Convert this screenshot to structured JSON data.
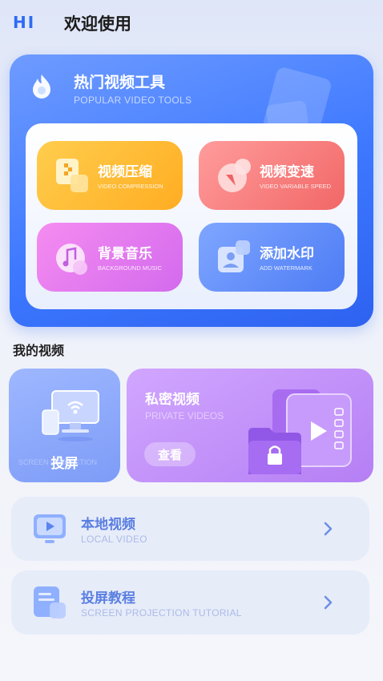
{
  "header": {
    "logo": "HI",
    "welcome": "欢迎使用"
  },
  "hero": {
    "title": "热门视频工具",
    "subtitle": "POPULAR VIDEO TOOLS",
    "tools": [
      {
        "label": "视频压缩",
        "sub": "VIDEO COMPRESSION",
        "icon": "compress-icon"
      },
      {
        "label": "视频变速",
        "sub": "VIDEO VARIABLE SPEED",
        "icon": "speed-icon"
      },
      {
        "label": "背景音乐",
        "sub": "BACKGROUND MUSIC",
        "icon": "music-note-icon"
      },
      {
        "label": "添加水印",
        "sub": "ADD WATERMARK",
        "icon": "watermark-icon"
      }
    ]
  },
  "my_videos": {
    "section_title": "我的视频",
    "cast": {
      "label": "投屏",
      "bg_text": "SCREEN PROJECTION"
    },
    "private": {
      "title": "私密视频",
      "subtitle": "PRIVATE VIDEOS",
      "button": "查看"
    }
  },
  "list": [
    {
      "title": "本地视频",
      "sub": "LOCAL VIDEO",
      "icon": "monitor-play-icon"
    },
    {
      "title": "投屏教程",
      "sub": "SCREEN PROJECTION TUTORIAL",
      "icon": "tutorial-doc-icon"
    }
  ],
  "colors": {
    "accent": "#2f6bf2",
    "compress": "#ffb82e",
    "speed": "#f57373",
    "music": "#e07cf0",
    "watermark": "#5d88f7",
    "private": "#c08cf7"
  }
}
